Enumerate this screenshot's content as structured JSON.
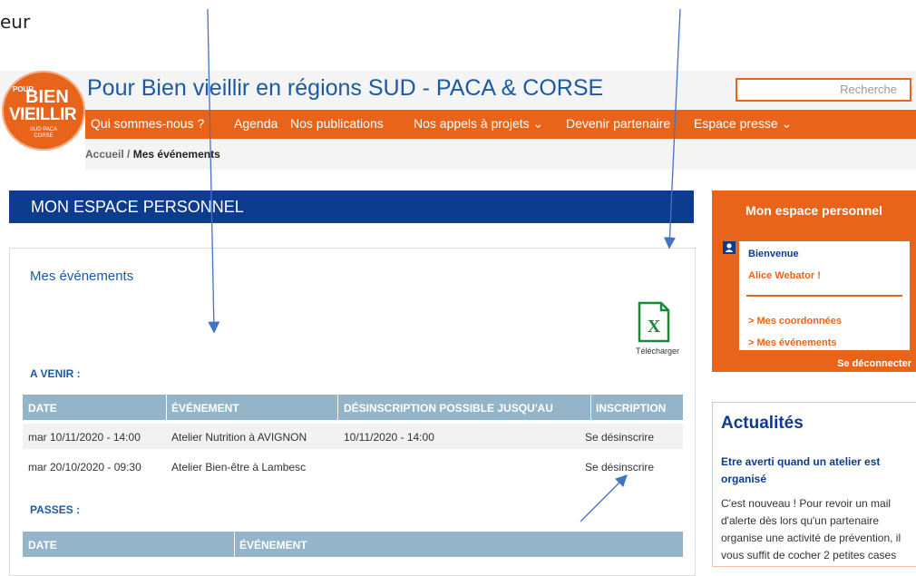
{
  "fragment_top": "eur",
  "site": {
    "logo": {
      "line1": "POUR",
      "line2": "BIEN",
      "line3": "VIEILLIR",
      "line4": "SUD PACA CORSE"
    },
    "title": "Pour Bien vieillir en régions SUD - PACA & CORSE",
    "search_placeholder": "Recherche"
  },
  "nav": {
    "items": [
      "Qui sommes-nous ?",
      "Agenda",
      "Nos publications",
      "Nos appels à projets ⌄",
      "Devenir partenaire",
      "Espace presse ⌄"
    ]
  },
  "breadcrumb": {
    "home": "Accueil",
    "separator": "/",
    "current": "Mes événements"
  },
  "main": {
    "section_title": "MON ESPACE PERSONNEL",
    "box_title": "Mes événements",
    "download_label": "Télécharger",
    "upcoming": {
      "label": "A VENIR :",
      "columns": [
        "DATE",
        "ÉVÉNEMENT",
        "DÉSINSCRIPTION POSSIBLE JUSQU'AU",
        "INSCRIPTION"
      ],
      "rows": [
        {
          "date": "mar 10/11/2020 - 14:00",
          "event": "Atelier Nutrition à AVIGNON",
          "deadline": "10/11/2020 - 14:00",
          "action": "Se désinscrire"
        },
        {
          "date": "mar 20/10/2020 - 09:30",
          "event": "Atelier Bien-être à Lambesc",
          "deadline": "",
          "action": "Se désinscrire"
        }
      ]
    },
    "past": {
      "label": "PASSES :",
      "columns": [
        "DATE",
        "ÉVÉNEMENT"
      ]
    }
  },
  "sidebar": {
    "title": "Mon espace personnel",
    "welcome": "Bienvenue",
    "user": "Alice Webator !",
    "links": [
      "> Mes coordonnées",
      "> Mes événements"
    ],
    "logout": "Se déconnecter"
  },
  "news": {
    "title": "Actualités",
    "headline": "Etre averti quand un atelier est organisé",
    "body": "C'est nouveau ! Pour revoir un mail d'alerte dès lors qu'un partenaire organise une activité de prévention, il vous suffit de cocher 2 petites cases"
  },
  "colors": {
    "orange": "#e8641a",
    "navy": "#0d3c8f",
    "blue": "#1d5aa6",
    "table_head": "#94b5c9"
  }
}
